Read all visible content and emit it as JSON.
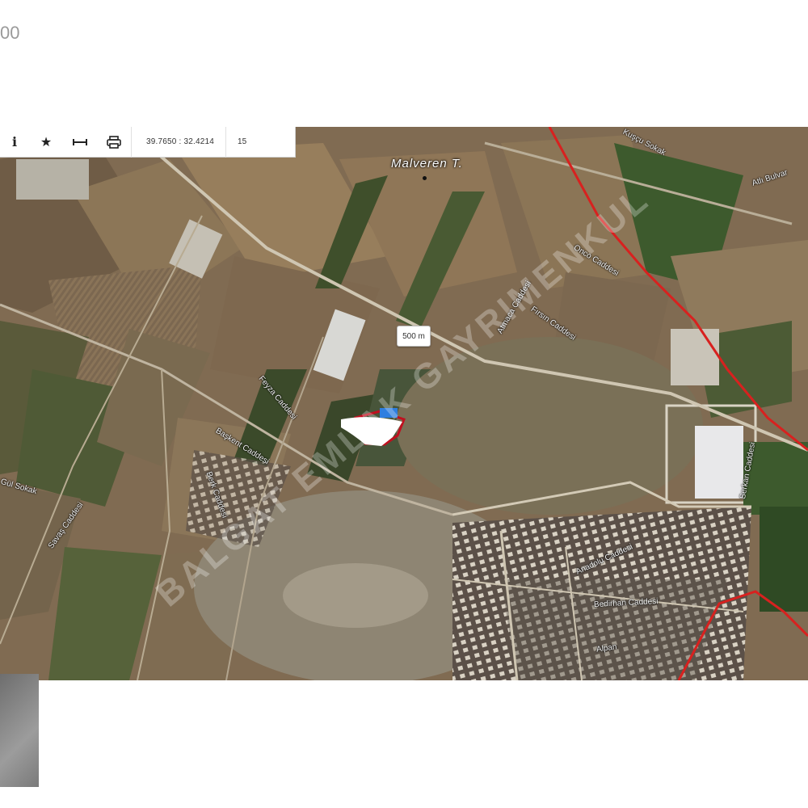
{
  "header": {
    "corner_text": "00"
  },
  "toolbar": {
    "info_icon": "info-icon",
    "favorite_icon": "star-icon",
    "measure_icon": "measure-icon",
    "print_icon": "printer-icon",
    "coordinates": "39.7650 : 32.4214",
    "zoom_level": "15"
  },
  "map": {
    "scale_label": "500 m",
    "poi": {
      "label": "Malveren T."
    },
    "streets": [
      "Atlı Bulvar",
      "Kuşçu Sokak",
      "Onco Caddesi",
      "Atmaca Caddesi",
      "Fırsın Caddesi",
      "Feyza Caddesi",
      "Başkent Caddesi",
      "Berk Caddesi",
      "Savaş Caddesi",
      "Gül Sokak",
      "Anadolu Caddesi",
      "Bedirhan Caddesi",
      "Alpan",
      "Serkan Caddesi"
    ],
    "watermark": "BALGAT EMLAK GAYRIMENKUL",
    "boundary_color": "#d8211f",
    "parcel_color": "#c0101f"
  },
  "thumbnail": {
    "label": ""
  }
}
